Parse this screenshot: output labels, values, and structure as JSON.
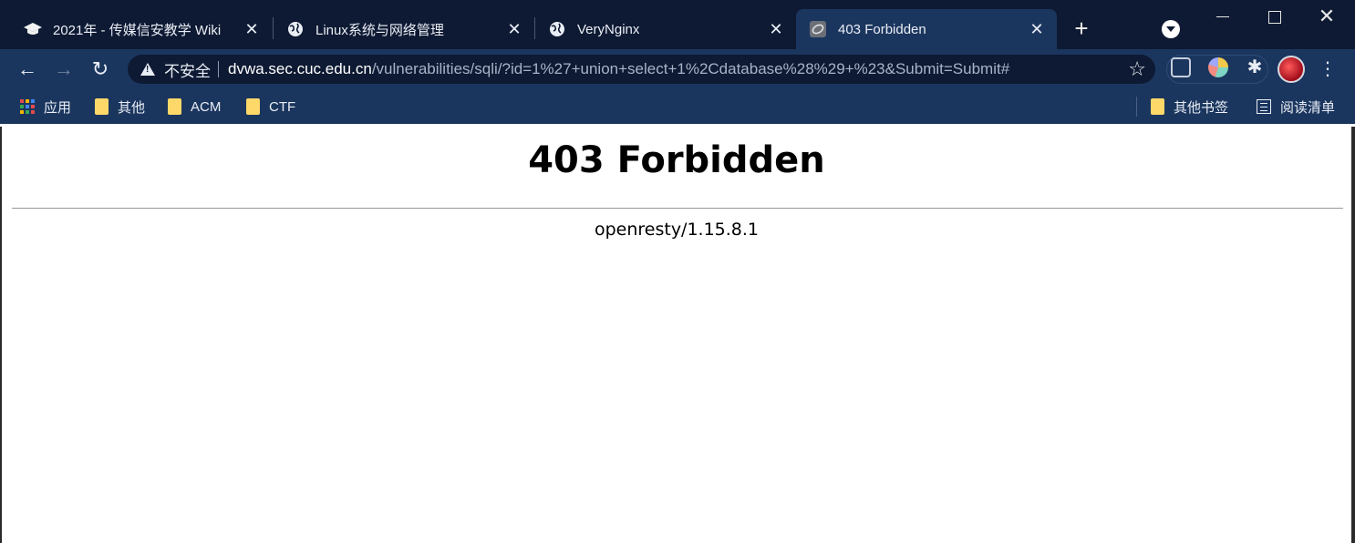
{
  "browser": {
    "tabs": [
      {
        "title": "2021年 - 传媒信安教学 Wiki",
        "icon": "graduation-cap-icon",
        "close": "✕",
        "active": false
      },
      {
        "title": "Linux系统与网络管理",
        "icon": "globe-icon",
        "close": "✕",
        "active": false
      },
      {
        "title": "VeryNginx",
        "icon": "globe-icon",
        "close": "✕",
        "active": false
      },
      {
        "title": "403 Forbidden",
        "icon": "verynginx-favicon-icon",
        "close": "✕",
        "active": true
      }
    ],
    "new_tab": "+",
    "window": {
      "close": "✕"
    }
  },
  "toolbar": {
    "back": "←",
    "forward": "→",
    "reload": "↻",
    "security_label": "不安全",
    "url_host": "dvwa.sec.cuc.edu.cn",
    "url_path": "/vulnerabilities/sqli/?id=1%27+union+select+1%2Cdatabase%28%29+%23&Submit=Submit#",
    "star": "☆",
    "puzzle": "✱",
    "menu": "⋮"
  },
  "bookmarks": {
    "apps": "应用",
    "items": [
      "其他",
      "ACM",
      "CTF"
    ],
    "other_bookmarks": "其他书签",
    "reading_list": "阅读清单"
  },
  "page": {
    "heading": "403 Forbidden",
    "server": "openresty/1.15.8.1"
  },
  "colors": {
    "tabstrip_bg": "#0e1a33",
    "toolbar_bg": "#1b365e",
    "omnibox_bg": "#0e1a33",
    "page_bg": "#ffffff"
  }
}
